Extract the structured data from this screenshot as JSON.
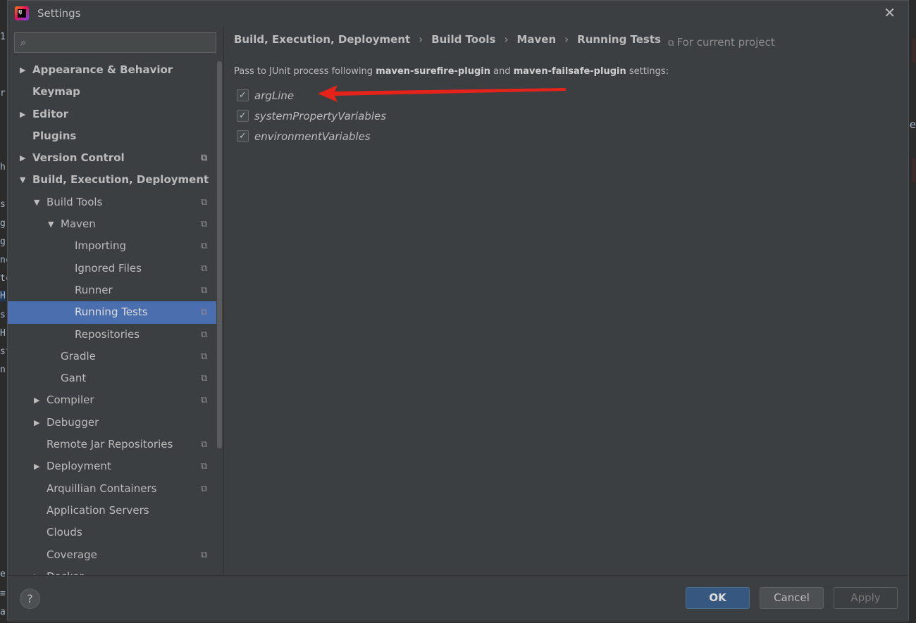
{
  "window": {
    "title": "Settings",
    "close_glyph": "✕",
    "app_icon_text": "IJ"
  },
  "search": {
    "placeholder": "",
    "icon_glyph": "⌕"
  },
  "sidebar": {
    "items": [
      {
        "label": "Appearance & Behavior",
        "level": 0,
        "arrow": "▶",
        "bold": true,
        "copy": false,
        "selected": false
      },
      {
        "label": "Keymap",
        "level": 0,
        "arrow": "",
        "bold": true,
        "copy": false,
        "selected": false
      },
      {
        "label": "Editor",
        "level": 0,
        "arrow": "▶",
        "bold": true,
        "copy": false,
        "selected": false
      },
      {
        "label": "Plugins",
        "level": 0,
        "arrow": "",
        "bold": true,
        "copy": false,
        "selected": false
      },
      {
        "label": "Version Control",
        "level": 0,
        "arrow": "▶",
        "bold": true,
        "copy": true,
        "selected": false
      },
      {
        "label": "Build, Execution, Deployment",
        "level": 0,
        "arrow": "▼",
        "bold": true,
        "copy": false,
        "selected": false
      },
      {
        "label": "Build Tools",
        "level": 1,
        "arrow": "▼",
        "bold": false,
        "copy": true,
        "selected": false
      },
      {
        "label": "Maven",
        "level": 2,
        "arrow": "▼",
        "bold": false,
        "copy": true,
        "selected": false
      },
      {
        "label": "Importing",
        "level": 3,
        "arrow": "",
        "bold": false,
        "copy": true,
        "selected": false
      },
      {
        "label": "Ignored Files",
        "level": 3,
        "arrow": "",
        "bold": false,
        "copy": true,
        "selected": false
      },
      {
        "label": "Runner",
        "level": 3,
        "arrow": "",
        "bold": false,
        "copy": true,
        "selected": false
      },
      {
        "label": "Running Tests",
        "level": 3,
        "arrow": "",
        "bold": false,
        "copy": true,
        "selected": true
      },
      {
        "label": "Repositories",
        "level": 3,
        "arrow": "",
        "bold": false,
        "copy": true,
        "selected": false
      },
      {
        "label": "Gradle",
        "level": 2,
        "arrow": "",
        "bold": false,
        "copy": true,
        "selected": false
      },
      {
        "label": "Gant",
        "level": 2,
        "arrow": "",
        "bold": false,
        "copy": true,
        "selected": false
      },
      {
        "label": "Compiler",
        "level": 1,
        "arrow": "▶",
        "bold": false,
        "copy": true,
        "selected": false
      },
      {
        "label": "Debugger",
        "level": 1,
        "arrow": "▶",
        "bold": false,
        "copy": false,
        "selected": false
      },
      {
        "label": "Remote Jar Repositories",
        "level": 1,
        "arrow": "",
        "bold": false,
        "copy": true,
        "selected": false
      },
      {
        "label": "Deployment",
        "level": 1,
        "arrow": "▶",
        "bold": false,
        "copy": true,
        "selected": false
      },
      {
        "label": "Arquillian Containers",
        "level": 1,
        "arrow": "",
        "bold": false,
        "copy": true,
        "selected": false
      },
      {
        "label": "Application Servers",
        "level": 1,
        "arrow": "",
        "bold": false,
        "copy": false,
        "selected": false
      },
      {
        "label": "Clouds",
        "level": 1,
        "arrow": "",
        "bold": false,
        "copy": false,
        "selected": false
      },
      {
        "label": "Coverage",
        "level": 1,
        "arrow": "",
        "bold": false,
        "copy": true,
        "selected": false
      },
      {
        "label": "Docker",
        "level": 1,
        "arrow": "▶",
        "bold": false,
        "copy": false,
        "selected": false
      }
    ],
    "copy_glyph": "⧉"
  },
  "breadcrumb": {
    "items": [
      "Build, Execution, Deployment",
      "Build Tools",
      "Maven",
      "Running Tests"
    ],
    "separator": "›"
  },
  "scope": {
    "icon_glyph": "⧉",
    "label": "For current project"
  },
  "description": {
    "prefix": "Pass to JUnit process following ",
    "plugin1": "maven-surefire-plugin",
    "middle": " and ",
    "plugin2": "maven-failsafe-plugin",
    "suffix": " settings:"
  },
  "options": [
    {
      "label": "argLine",
      "checked": true
    },
    {
      "label": "systemPropertyVariables",
      "checked": true
    },
    {
      "label": "environmentVariables",
      "checked": true
    }
  ],
  "footer": {
    "help_label": "?",
    "ok_label": "OK",
    "cancel_label": "Cancel",
    "apply_label": "Apply"
  },
  "background_fragments": {
    "left": [
      "1",
      "r",
      "h",
      "s",
      "g",
      "g",
      "nc",
      "tc",
      "H",
      "s",
      "H",
      "st",
      "n",
      "e",
      "≡",
      "a"
    ],
    "right": [
      "e"
    ]
  },
  "colors": {
    "selection": "#4b6eaf",
    "ok_button": "#365880",
    "annotation_arrow": "#e5231b"
  }
}
